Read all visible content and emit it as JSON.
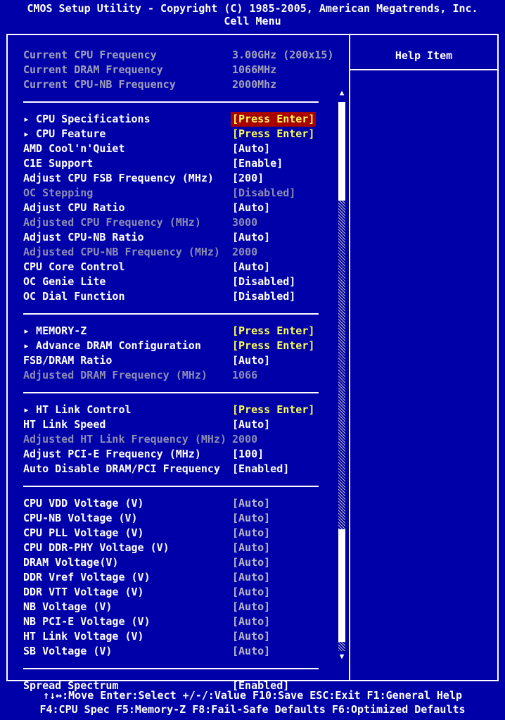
{
  "header": {
    "line1": "CMOS Setup Utility - Copyright (C) 1985-2005, American Megatrends, Inc.",
    "line2": "Cell Menu"
  },
  "help": {
    "title": "Help Item"
  },
  "info": [
    {
      "label": "Current CPU Frequency",
      "value": "3.00GHz (200x15)"
    },
    {
      "label": "Current DRAM Frequency",
      "value": "1066MHz"
    },
    {
      "label": "Current CPU-NB Frequency",
      "value": "2000Mhz"
    }
  ],
  "group1": [
    {
      "label": "▸ CPU Specifications",
      "value": "[Press Enter]",
      "style": "highlight"
    },
    {
      "label": "▸ CPU Feature",
      "value": "[Press Enter]",
      "style": "yellow"
    },
    {
      "label": "AMD Cool'n'Quiet",
      "value": "[Auto]",
      "style": ""
    },
    {
      "label": "C1E Support",
      "value": "[Enable]",
      "style": ""
    },
    {
      "label": "Adjust CPU FSB Frequency (MHz)",
      "value": "[200]",
      "style": ""
    },
    {
      "label": "OC Stepping",
      "value": "[Disabled]",
      "style": "disabled"
    },
    {
      "label": "Adjust CPU Ratio",
      "value": "[Auto]",
      "style": ""
    },
    {
      "label": "Adjusted CPU Frequency (MHz)",
      "value": "3000",
      "style": "disabled"
    },
    {
      "label": "Adjust CPU-NB Ratio",
      "value": "[Auto]",
      "style": ""
    },
    {
      "label": "Adjusted CPU-NB Frequency (MHz)",
      "value": "2000",
      "style": "disabled"
    },
    {
      "label": "CPU Core Control",
      "value": "[Auto]",
      "style": ""
    },
    {
      "label": "OC Genie Lite",
      "value": "[Disabled]",
      "style": ""
    },
    {
      "label": "OC Dial Function",
      "value": "[Disabled]",
      "style": ""
    }
  ],
  "group2": [
    {
      "label": "▸ MEMORY-Z",
      "value": "[Press Enter]",
      "style": "yellow"
    },
    {
      "label": "▸ Advance DRAM Configuration",
      "value": "[Press Enter]",
      "style": "yellow"
    },
    {
      "label": "FSB/DRAM Ratio",
      "value": "[Auto]",
      "style": ""
    },
    {
      "label": "Adjusted DRAM Frequency (MHz)",
      "value": "1066",
      "style": "disabled"
    }
  ],
  "group3": [
    {
      "label": "▸ HT Link Control",
      "value": "[Press Enter]",
      "style": "yellow"
    },
    {
      "label": "HT Link Speed",
      "value": "[Auto]",
      "style": ""
    },
    {
      "label": "Adjusted HT Link Frequency (MHz)",
      "value": "2000",
      "style": "disabled"
    },
    {
      "label": "Adjust PCI-E Frequency (MHz)",
      "value": "[100]",
      "style": ""
    },
    {
      "label": "Auto Disable DRAM/PCI Frequency",
      "value": "[Enabled]",
      "style": ""
    }
  ],
  "group4": [
    {
      "label": "CPU VDD Voltage (V)",
      "value": "[Auto]",
      "style": "grey-val"
    },
    {
      "label": "CPU-NB Voltage (V)",
      "value": "[Auto]",
      "style": "grey-val"
    },
    {
      "label": "CPU PLL Voltage (V)",
      "value": "[Auto]",
      "style": "grey-val"
    },
    {
      "label": "CPU DDR-PHY Voltage (V)",
      "value": "[Auto]",
      "style": "grey-val"
    },
    {
      "label": "DRAM Voltage(V)",
      "value": "[Auto]",
      "style": "grey-val"
    },
    {
      "label": "DDR Vref Voltage (V)",
      "value": "[Auto]",
      "style": "grey-val"
    },
    {
      "label": "DDR VTT Voltage (V)",
      "value": "[Auto]",
      "style": "grey-val"
    },
    {
      "label": "NB Voltage (V)",
      "value": "[Auto]",
      "style": "grey-val"
    },
    {
      "label": "NB PCI-E Voltage (V)",
      "value": "[Auto]",
      "style": "grey-val"
    },
    {
      "label": "HT Link Voltage (V)",
      "value": "[Auto]",
      "style": "grey-val"
    },
    {
      "label": "SB Voltage (V)",
      "value": "[Auto]",
      "style": "grey-val"
    }
  ],
  "group5": [
    {
      "label": "Spread Spectrum",
      "value": "[Enabled]",
      "style": ""
    }
  ],
  "footer": {
    "line1": "↑↓↔:Move  Enter:Select  +/-/:Value  F10:Save  ESC:Exit  F1:General Help",
    "line2": "F4:CPU Spec  F5:Memory-Z  F8:Fail-Safe Defaults    F6:Optimized Defaults"
  },
  "scrollbar": {
    "up_icon": "▲",
    "down_icon": "▼"
  }
}
